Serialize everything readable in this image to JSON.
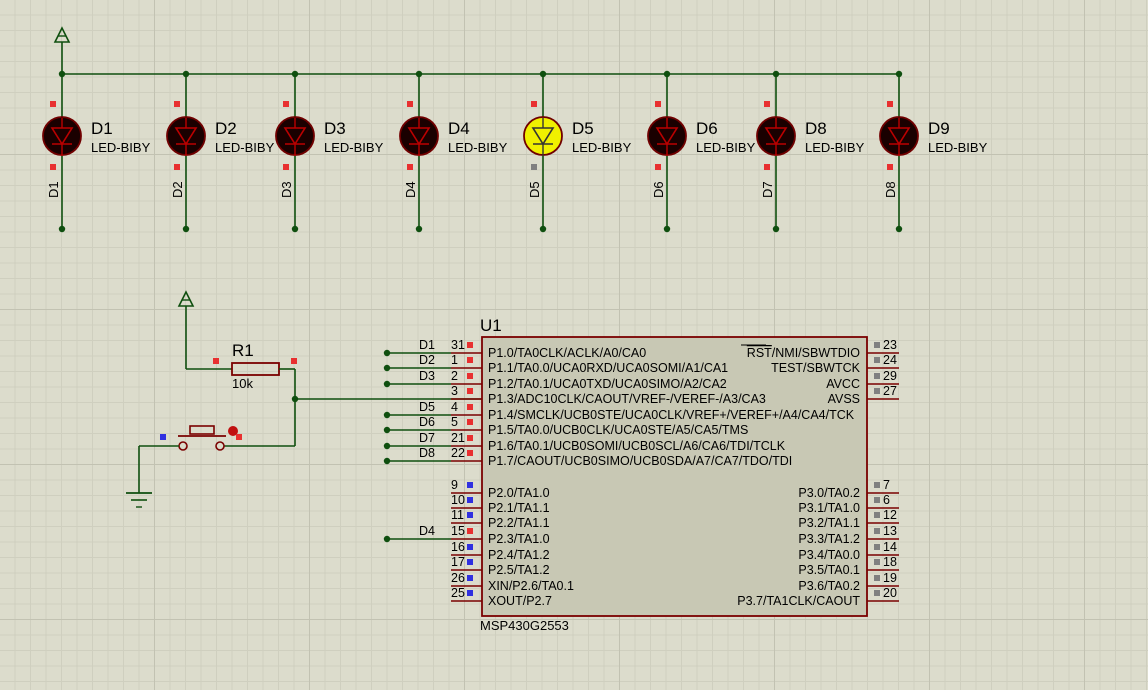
{
  "leds": [
    {
      "ref": "D1",
      "type": "LED-BIBY",
      "pin_label": "D1",
      "lit": false
    },
    {
      "ref": "D2",
      "type": "LED-BIBY",
      "pin_label": "D2",
      "lit": false
    },
    {
      "ref": "D3",
      "type": "LED-BIBY",
      "pin_label": "D3",
      "lit": false
    },
    {
      "ref": "D4",
      "type": "LED-BIBY",
      "pin_label": "D4",
      "lit": false
    },
    {
      "ref": "D5",
      "type": "LED-BIBY",
      "pin_label": "D5",
      "lit": true
    },
    {
      "ref": "D6",
      "type": "LED-BIBY",
      "pin_label": "D6",
      "lit": false
    },
    {
      "ref": "D8",
      "type": "LED-BIBY",
      "pin_label": "D7",
      "lit": false
    },
    {
      "ref": "D9",
      "type": "LED-BIBY",
      "pin_label": "D8",
      "lit": false
    }
  ],
  "resistor": {
    "ref": "R1",
    "value": "10k"
  },
  "ic": {
    "ref": "U1",
    "part": "MSP430G2553",
    "left_pins": [
      {
        "num": "31",
        "name": "P1.0/TA0CLK/ACLK/A0/CA0",
        "net": "D1"
      },
      {
        "num": "1",
        "name": "P1.1/TA0.0/UCA0RXD/UCA0SOMI/A1/CA1",
        "net": "D2"
      },
      {
        "num": "2",
        "name": "P1.2/TA0.1/UCA0TXD/UCA0SIMO/A2/CA2",
        "net": "D3"
      },
      {
        "num": "3",
        "name": "P1.3/ADC10CLK/CAOUT/VREF-/VEREF-/A3/CA3",
        "net": ""
      },
      {
        "num": "4",
        "name": "P1.4/SMCLK/UCB0STE/UCA0CLK/VREF+/VEREF+/A4/CA4/TCK",
        "net": "D5"
      },
      {
        "num": "5",
        "name": "P1.5/TA0.0/UCB0CLK/UCA0STE/A5/CA5/TMS",
        "net": "D6"
      },
      {
        "num": "21",
        "name": "P1.6/TA0.1/UCB0SOMI/UCB0SCL/A6/CA6/TDI/TCLK",
        "net": "D7"
      },
      {
        "num": "22",
        "name": "P1.7/CAOUT/UCB0SIMO/UCB0SDA/A7/CA7/TDO/TDI",
        "net": "D8"
      },
      {
        "num": "9",
        "name": "P2.0/TA1.0",
        "net": ""
      },
      {
        "num": "10",
        "name": "P2.1/TA1.1",
        "net": ""
      },
      {
        "num": "11",
        "name": "P2.2/TA1.1",
        "net": ""
      },
      {
        "num": "15",
        "name": "P2.3/TA1.0",
        "net": "D4"
      },
      {
        "num": "16",
        "name": "P2.4/TA1.2",
        "net": ""
      },
      {
        "num": "17",
        "name": "P2.5/TA1.2",
        "net": ""
      },
      {
        "num": "26",
        "name": "XIN/P2.6/TA0.1",
        "net": ""
      },
      {
        "num": "25",
        "name": "XOUT/P2.7",
        "net": ""
      }
    ],
    "right_pins": [
      {
        "num": "23",
        "name_overline": "RST",
        "name": "/NMI/SBWTDIO"
      },
      {
        "num": "24",
        "name_overline": "",
        "name": "TEST/SBWTCK"
      },
      {
        "num": "29",
        "name_overline": "",
        "name": "AVCC"
      },
      {
        "num": "27",
        "name_overline": "",
        "name": "AVSS"
      },
      {
        "num": "7",
        "name_overline": "",
        "name": "P3.0/TA0.2"
      },
      {
        "num": "6",
        "name_overline": "",
        "name": "P3.1/TA1.0"
      },
      {
        "num": "12",
        "name_overline": "",
        "name": "P3.2/TA1.1"
      },
      {
        "num": "13",
        "name_overline": "",
        "name": "P3.3/TA1.2"
      },
      {
        "num": "14",
        "name_overline": "",
        "name": "P3.4/TA0.0"
      },
      {
        "num": "18",
        "name_overline": "",
        "name": "P3.5/TA0.1"
      },
      {
        "num": "19",
        "name_overline": "",
        "name": "P3.6/TA0.2"
      },
      {
        "num": "20",
        "name_overline": "",
        "name": "P3.7/TA1CLK/CAOUT"
      }
    ]
  },
  "colors": {
    "wire": "#0f4f0f",
    "ic_body": "#c8c8b4",
    "ic_outline": "#7a0000",
    "led_off": "#1a0000",
    "led_on": "#f0f000",
    "pin_red": "#e83030",
    "pin_blue": "#3030e0",
    "pin_grey": "#808080"
  }
}
